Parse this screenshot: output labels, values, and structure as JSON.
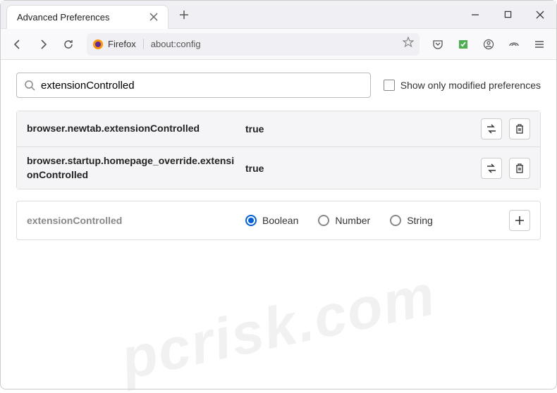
{
  "tab": {
    "title": "Advanced Preferences"
  },
  "urlbar": {
    "brand": "Firefox",
    "url": "about:config"
  },
  "search": {
    "value": "extensionControlled",
    "checkbox_label": "Show only modified preferences"
  },
  "prefs": [
    {
      "name": "browser.newtab.extensionControlled",
      "value": "true"
    },
    {
      "name": "browser.startup.homepage_override.extensionControlled",
      "value": "true"
    }
  ],
  "new_pref": {
    "name": "extensionControlled",
    "types": [
      "Boolean",
      "Number",
      "String"
    ],
    "selected": 0
  },
  "watermark": "pcrisk.com"
}
